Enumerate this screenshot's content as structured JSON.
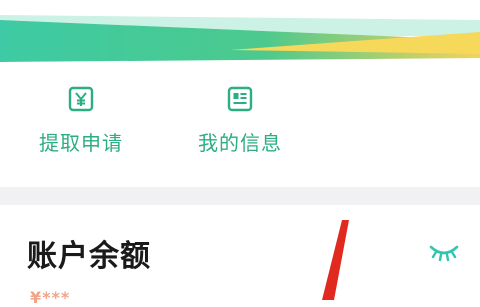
{
  "colors": {
    "accent": "#2bae82",
    "banner_green": "#3fc9a0",
    "banner_yellow": "#f6d85a",
    "annotation_red": "#e02a1f",
    "masked_amount": "#f1a489"
  },
  "actions": {
    "withdraw": {
      "label": "提取申请",
      "icon": "yen-icon"
    },
    "my_info": {
      "label": "我的信息",
      "icon": "id-card-icon"
    }
  },
  "balance": {
    "title": "账户余额",
    "masked_amount": "¥***",
    "visibility_icon": "eye-closed-icon"
  }
}
